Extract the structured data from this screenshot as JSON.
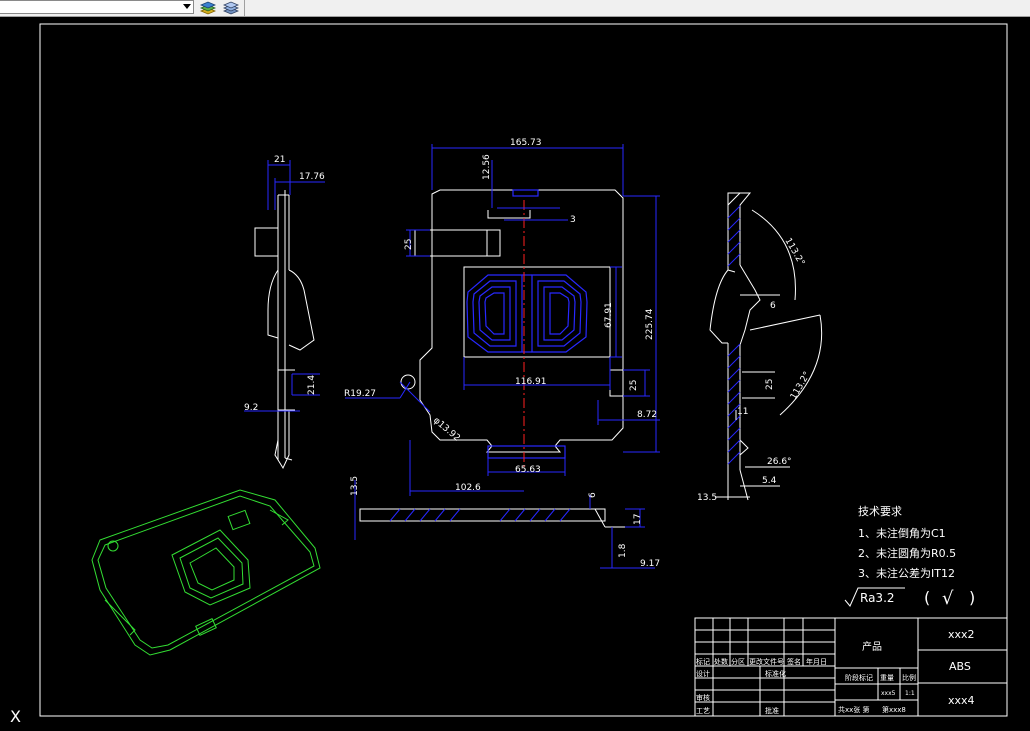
{
  "toolbar": {
    "layer_combo_value": "",
    "icons": [
      "layer-states-icon",
      "layer-previous-icon"
    ]
  },
  "front_view": {
    "dim_width": "165.73",
    "dim_top_offset": "12.56",
    "dim_slot": "3",
    "dim_left_block": "25",
    "dim_window_height": "67.91",
    "dim_window_width": "116.91",
    "dim_total_height": "225.74",
    "dim_tab_height": "25",
    "dim_tab_offset": "8.72",
    "dim_radius": "R19.27",
    "dim_hole": "φ13.92",
    "dim_left_offset": "102.6",
    "dim_bottom_tab": "65.63"
  },
  "left_view": {
    "dim_21": "21",
    "dim_17_76": "17.76",
    "dim_21_4": "21.4",
    "dim_9_2": "9.2"
  },
  "right_view": {
    "dim_angle1": "113.2°",
    "dim_6": "6",
    "dim_25": "25",
    "dim_angle2": "113.2°",
    "dim_11": "11",
    "dim_26_6": "26.6°",
    "dim_5_4": "5.4",
    "dim_13_5": "13.5"
  },
  "bottom_view": {
    "dim_13_5": "13.5",
    "dim_6": "6",
    "dim_17": "17",
    "dim_1_8": "1.8",
    "dim_9_17": "9.17"
  },
  "tech_requirements": {
    "title": "技术要求",
    "items": [
      "1、未注倒角为C1",
      "2、未注圆角为R0.5",
      "3、未注公差为IT12"
    ]
  },
  "roughness": {
    "symbol_text": "Ra3.2",
    "paren_open": "(",
    "check": "√",
    "paren_close": ")"
  },
  "title_block": {
    "product": "产品",
    "part_no": "xxx2",
    "material": "ABS",
    "drawing_no": "xxx4",
    "rev_headers": [
      "标记",
      "处数",
      "分区",
      "更改文件号",
      "签名",
      "年月日"
    ],
    "design": "设计",
    "standardize": "标准化",
    "check": "审核",
    "process": "工艺",
    "approve": "批准",
    "stage_mark": "阶段标记",
    "weight": "重量",
    "scale": "比例",
    "weight_value": "xxx5",
    "scale_value": "1:1",
    "sheets": "共xx张 第",
    "sheet_no": "第xxx8"
  },
  "ucs_icon": "X",
  "colors": {
    "white": "#ffffff",
    "blue": "#2828ff",
    "green": "#33dd33",
    "red": "#ff2020",
    "background": "#000000"
  }
}
